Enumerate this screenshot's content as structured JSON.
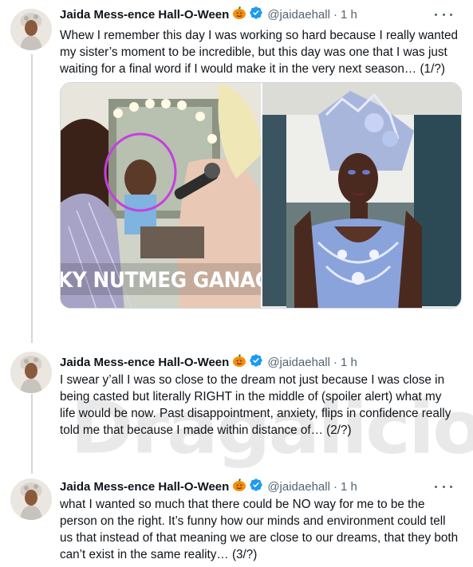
{
  "tweets": [
    {
      "name": "Jaida Mess-ence Hall-O-Ween",
      "emoji": "pumpkin",
      "verified": true,
      "handle": "@jaidaehall",
      "separator": "·",
      "time": "1 h",
      "text": "Whew I remember this day I was working so hard because I really wanted my sister’s moment to be incredible, but this day was one that I was just waiting for a final word if I would make it in the very next season… (1/?)",
      "media": {
        "left_caption": "KY NUTMEG GANAC"
      }
    },
    {
      "name": "Jaida Mess-ence Hall-O-Ween",
      "emoji": "pumpkin",
      "verified": true,
      "handle": "@jaidaehall",
      "separator": "·",
      "time": "1 h",
      "text": "I swear y’all I was so close to the dream not just because I was close in being casted but literally RIGHT in the middle of (spoiler alert) what my life would be now. Past disappointment, anxiety, flips in confidence really told me that because I made within distance of… (2/?)"
    },
    {
      "name": "Jaida Mess-ence Hall-O-Ween",
      "emoji": "pumpkin",
      "verified": true,
      "handle": "@jaidaehall",
      "separator": "·",
      "time": "1 h",
      "text": "what I wanted so much that there could be NO way for me to be the person on the right. It’s funny how our minds and environment could tell us that instead of that meaning we are close to our dreams, that they both can’t exist in the same reality… (3/?)"
    }
  ],
  "watermark": "Dragalicious",
  "colors": {
    "text": "#0f1419",
    "secondary": "#536471",
    "verified": "#1d9bf0",
    "border": "#cfd9de"
  },
  "icons": [
    "avatar",
    "pumpkin-emoji-icon",
    "verified-badge-icon",
    "more-options-icon"
  ]
}
